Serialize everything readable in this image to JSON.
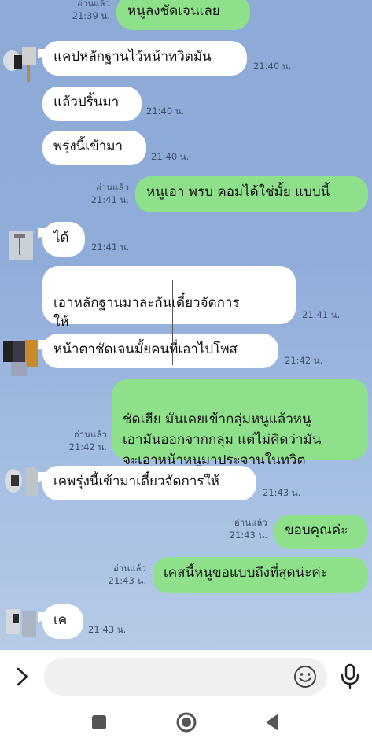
{
  "messages": [
    {
      "side": "out",
      "text": "หนูลงชัดเจนเลย",
      "read": "อ่านแล้ว",
      "time": "21:39 น."
    },
    {
      "side": "in",
      "text": "แคปหลักฐานไว้หน้าทวิตมัน",
      "time": "21:40 น."
    },
    {
      "side": "in",
      "text": "แล้วปริ้นมา",
      "time": "21:40 น."
    },
    {
      "side": "in",
      "text": "พรุ่งนี้เข้ามา",
      "time": "21:40 น."
    },
    {
      "side": "out",
      "text": "หนูเอา พรบ คอมได้ใช่มั้ย แบบนี้",
      "read": "อ่านแล้ว",
      "time": "21:41 น."
    },
    {
      "side": "in",
      "text": "ได้",
      "time": "21:41 น."
    },
    {
      "side": "in",
      "text": "เอาหลักฐานมาละกันเดี๋ยวจัดการ\nให้",
      "time": "21:41 น."
    },
    {
      "side": "in",
      "text": "หน้าตาชัดเจนมั้ยคนที่เอาไปโพส",
      "time": "21:42 น."
    },
    {
      "side": "out",
      "text": "ชัดเฮีย มันเคยเข้ากลุ่มหนูแล้วหนู\nเอามันออกจากกลุ่ม แต่ไม่คิดว่ามัน\nจะเอาหน้าหนูมาประจานในทวิต",
      "read": "อ่านแล้ว",
      "time": "21:42 น."
    },
    {
      "side": "in",
      "text": "เคพรุ่งนี้เข้ามาเดี๋ยวจัดการให้",
      "time": "21:43 น."
    },
    {
      "side": "out",
      "text": "ขอบคุณค่ะ",
      "read": "อ่านแล้ว",
      "time": "21:43 น."
    },
    {
      "side": "out",
      "text": "เคสนี้หนูขอแบบถึงที่สุดน่ะค่ะ",
      "read": "อ่านแล้ว",
      "time": "21:43 น."
    },
    {
      "side": "in",
      "text": "เค",
      "time": "21:43 น."
    }
  ],
  "input": {
    "placeholder": "",
    "value": ""
  },
  "icons": {
    "expand": "chevron-right-icon",
    "emoji": "smiley-icon",
    "mic": "microphone-icon",
    "nav_recent": "square-recent-apps-icon",
    "nav_home": "circle-home-icon",
    "nav_back": "triangle-back-icon"
  },
  "colors": {
    "outgoing_bubble": "#8ee08a",
    "incoming_bubble": "#ffffff",
    "chat_background": "#8eaad6"
  }
}
